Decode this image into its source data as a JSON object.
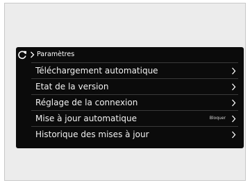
{
  "breadcrumb": {
    "refresh_icon": "refresh-icon",
    "separator_icon": "chevron-right-icon",
    "label": "Paramètres"
  },
  "menu": {
    "items": [
      {
        "label": "Téléchargement automatique",
        "value": "",
        "icon": "chevron-right-icon"
      },
      {
        "label": "Etat de la version",
        "value": "",
        "icon": "chevron-right-icon"
      },
      {
        "label": "Réglage de la connexion",
        "value": "",
        "icon": "chevron-right-icon"
      },
      {
        "label": "Mise à jour automatique",
        "value": "Bloquer",
        "icon": "chevron-right-icon"
      },
      {
        "label": "Historique des mises à jour",
        "value": "",
        "icon": "chevron-right-icon"
      }
    ]
  },
  "colors": {
    "screen_background": "#0b0b0b",
    "text": "#f2f2f2",
    "divider": "#3a3a3a",
    "outer_background": "#ececec"
  }
}
